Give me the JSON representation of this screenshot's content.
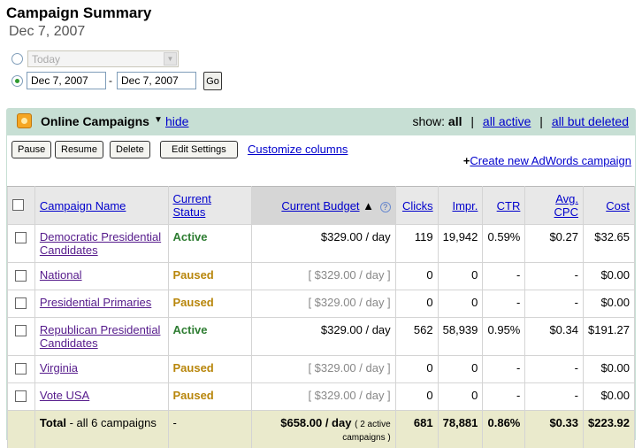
{
  "page": {
    "title": "Campaign Summary",
    "date": "Dec 7, 2007"
  },
  "date_range": {
    "preset_value": "Today",
    "start_date": "Dec 7, 2007",
    "separator": "-",
    "end_date": "Dec 7, 2007",
    "go_label": "Go"
  },
  "panel": {
    "title": "Online Campaigns",
    "hide_label": "hide",
    "show_label": "show:",
    "filters": [
      "all",
      "all active",
      "all but deleted"
    ]
  },
  "toolbar": {
    "pause_label": "Pause",
    "resume_label": "Resume",
    "delete_label": "Delete",
    "edit_settings_label": "Edit Settings",
    "customize_label": "Customize columns",
    "create_plus": "+",
    "create_label": "Create new AdWords campaign"
  },
  "table": {
    "headers": {
      "name": "Campaign Name",
      "status": "Current Status",
      "budget": "Current Budget",
      "sort_arrow": "▲",
      "help": "?",
      "clicks": "Clicks",
      "impr": "Impr.",
      "ctr": "CTR",
      "cpc": "Avg. CPC",
      "cost": "Cost"
    },
    "rows": [
      {
        "name": "Democratic Presidential Candidates",
        "status": "Active",
        "budget": "$329.00 / day",
        "clicks": "119",
        "impr": "19,942",
        "ctr": "0.59%",
        "cpc": "$0.27",
        "cost": "$32.65"
      },
      {
        "name": "National",
        "status": "Paused",
        "budget": "[ $329.00 / day ]",
        "clicks": "0",
        "impr": "0",
        "ctr": "-",
        "cpc": "-",
        "cost": "$0.00"
      },
      {
        "name": "Presidential Primaries",
        "status": "Paused",
        "budget": "[ $329.00 / day ]",
        "clicks": "0",
        "impr": "0",
        "ctr": "-",
        "cpc": "-",
        "cost": "$0.00"
      },
      {
        "name": "Republican Presidential Candidates",
        "status": "Active",
        "budget": "$329.00 / day",
        "clicks": "562",
        "impr": "58,939",
        "ctr": "0.95%",
        "cpc": "$0.34",
        "cost": "$191.27"
      },
      {
        "name": "Virginia",
        "status": "Paused",
        "budget": "[ $329.00 / day ]",
        "clicks": "0",
        "impr": "0",
        "ctr": "-",
        "cpc": "-",
        "cost": "$0.00"
      },
      {
        "name": "Vote USA",
        "status": "Paused",
        "budget": "[ $329.00 / day ]",
        "clicks": "0",
        "impr": "0",
        "ctr": "-",
        "cpc": "-",
        "cost": "$0.00"
      }
    ],
    "total": {
      "label": "Total",
      "suffix": "- all 6 campaigns",
      "status": "-",
      "budget": "$658.00 / day",
      "budget_note": "( 2 active campaigns )",
      "clicks": "681",
      "impr": "78,881",
      "ctr": "0.86%",
      "cpc": "$0.33",
      "cost": "$223.92"
    }
  },
  "colors": {
    "panel_header": "#c7dfd4",
    "active_status": "#2e7d32",
    "paused_status": "#b8860b",
    "link": "#0000cc",
    "total_row": "#eaeacc"
  }
}
